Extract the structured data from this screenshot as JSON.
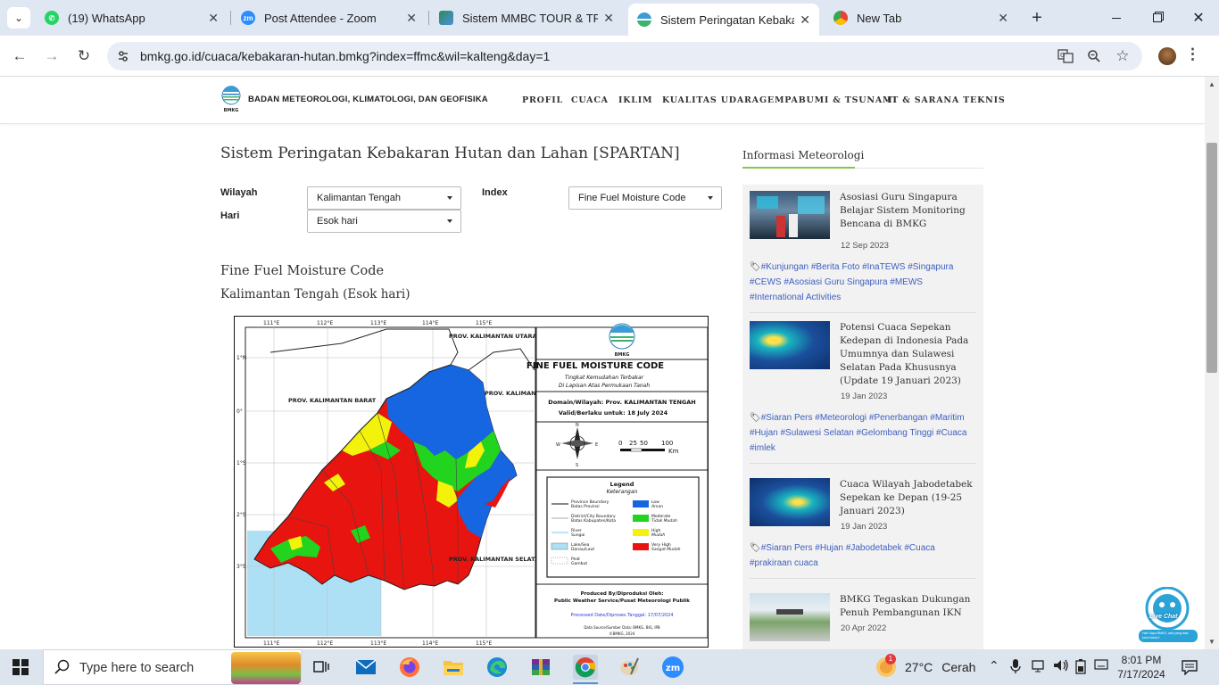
{
  "browser": {
    "tabs": [
      {
        "title": "(19) WhatsApp",
        "icon": "whatsapp-icon",
        "active": false
      },
      {
        "title": "Post Attendee - Zoom",
        "icon": "zoom-icon",
        "active": false
      },
      {
        "title": "Sistem MMBC TOUR & TRAV",
        "icon": "globe-icon",
        "active": false
      },
      {
        "title": "Sistem Peringatan Kebakara",
        "icon": "bmkg-icon",
        "active": true
      },
      {
        "title": "New Tab",
        "icon": "chrome-icon",
        "active": false
      }
    ],
    "url": "bmkg.go.id/cuaca/kebakaran-hutan.bmkg?index=ffmc&wil=kalteng&day=1",
    "close_glyph": "✕",
    "newtab_glyph": "+"
  },
  "site": {
    "name": "BADAN METEOROLOGI, KLIMATOLOGI, DAN GEOFISIKA",
    "logo_text": "BMKG",
    "nav": [
      "PROFIL",
      "CUACA",
      "IKLIM",
      "KUALITAS UDARA",
      "GEMPABUMI & TSUNAMI",
      "IT & SARANA TEKNIS"
    ]
  },
  "main": {
    "title": "Sistem Peringatan Kebakaran Hutan dan Lahan [SPARTAN]",
    "filters": {
      "wilayah_label": "Wilayah",
      "wilayah_value": "Kalimantan Tengah",
      "hari_label": "Hari",
      "hari_value": "Esok hari",
      "index_label": "Index",
      "index_value": "Fine Fuel Moisture Code"
    },
    "subtitle": "Fine Fuel Moisture Code",
    "region_day": "Kalimantan Tengah (Esok hari)"
  },
  "map": {
    "heading": "FINE FUEL MOISTURE CODE",
    "subheading1": "Tingkat Kemudahan Terbakar",
    "subheading2": "Di Lapisan Atas Permukaan Tanah",
    "domain_line": "Domain/Wilayah: Prov. KALIMANTAN TENGAH",
    "valid_line": "Valid/Berlaku untuk: 18 July 2024",
    "logo_text": "BMKG",
    "scale_labels": [
      "0",
      "25",
      "50",
      "100"
    ],
    "scale_unit": "Km",
    "compass": {
      "n": "N",
      "s": "S",
      "e": "E",
      "w": "W"
    },
    "legend_title": "Legend",
    "legend_subtitle": "Keterangan",
    "legend_lines": [
      {
        "en": "Province Boundary",
        "id": "Batas Provinsi"
      },
      {
        "en": "District/City Boundary",
        "id": "Batas Kabupaten/Kota"
      },
      {
        "en": "River",
        "id": "Sungai"
      },
      {
        "en": "Lake/Sea",
        "id": "Danau/Laut"
      },
      {
        "en": "Peat",
        "id": "Gambut"
      }
    ],
    "legend_classes": [
      {
        "en": "Low",
        "id": "Aman",
        "color": "#1566e0"
      },
      {
        "en": "Moderate",
        "id": "Tidak Mudah",
        "color": "#22d41e"
      },
      {
        "en": "High",
        "id": "Mudah",
        "color": "#f2f20a"
      },
      {
        "en": "Very High",
        "id": "Sangat Mudah",
        "color": "#e8140f"
      }
    ],
    "produced_by": "Produced By/Diproduksi Oleh:",
    "producer": "Public Weather Service/Pusat Meteorologi Publik",
    "processed": "Processed Date/Diproses Tanggal: 17/07/2024",
    "data_source": "Data Source/Sumber Data: BMKG, BIG, IPB",
    "copyright": "©BMKG, 2024",
    "lon_labels": [
      "111°E",
      "112°E",
      "113°E",
      "114°E",
      "115°E"
    ],
    "lat_labels": [
      "1°N",
      "0°",
      "1°S",
      "2°S",
      "3°S"
    ],
    "province_labels": [
      {
        "text": "PROV. KALIMANTAN BARAT"
      },
      {
        "text": "PROV. KALIMANTAN TIMUR"
      },
      {
        "text": "PROV. KALIMANTAN SELATAN"
      },
      {
        "text": "PROV. KALIMANTAN UTARA"
      }
    ]
  },
  "sidebar": {
    "title": "Informasi Meteorologi",
    "news": [
      {
        "title": "Asosiasi Guru Singapura Belajar Sistem Monitoring Bencana di BMKG",
        "date": "12 Sep 2023",
        "tags": "#Kunjungan #Berita Foto #InaTEWS #Singapura #CEWS #Asosiasi Guru Singapura #MEWS #International Activities"
      },
      {
        "title": "Potensi Cuaca Sepekan Kedepan di Indonesia Pada Umumnya dan Sulawesi Selatan Pada Khususnya (Update 19 Januari 2023)",
        "date": "19 Jan 2023",
        "tags": "#Siaran Pers #Meteorologi #Penerbangan #Maritim #Hujan #Sulawesi Selatan #Gelombang Tinggi #Cuaca #imlek"
      },
      {
        "title": "Cuaca Wilayah Jabodetabek Sepekan ke Depan (19-25 Januari 2023)",
        "date": "19 Jan 2023",
        "tags": "#Siaran Pers #Hujan #Jabodetabek #Cuaca #prakiraan cuaca"
      },
      {
        "title": "BMKG Tegaskan Dukungan Penuh Pembangunan IKN",
        "date": "20 Apr 2022",
        "tags": ""
      }
    ]
  },
  "livechat": {
    "label": "Live Chat",
    "sub": "Hai! Saya BMKG, ada yang bisa kami bantu?"
  },
  "taskbar": {
    "search_placeholder": "Type here to search",
    "weather_temp": "27°C",
    "weather_text": "Cerah",
    "weather_badge": "1",
    "time": "8:01 PM",
    "date": "7/17/2024"
  }
}
